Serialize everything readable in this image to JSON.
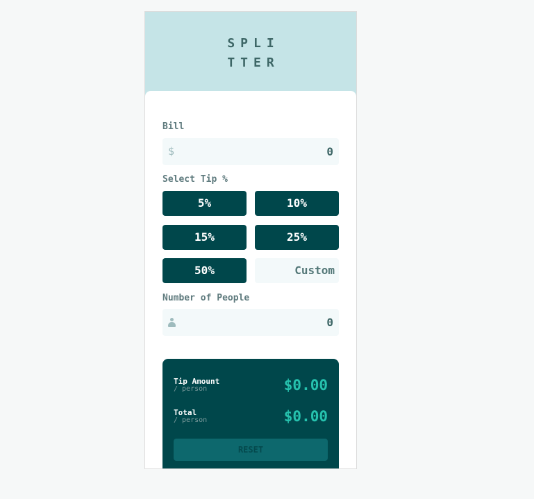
{
  "logo": {
    "line1": "SPLI",
    "line2": "TTER"
  },
  "bill": {
    "label": "Bill",
    "prefix": "$",
    "value": "0"
  },
  "tip": {
    "label": "Select Tip %",
    "options": [
      "5%",
      "10%",
      "15%",
      "25%",
      "50%"
    ],
    "custom_placeholder": "Custom"
  },
  "people": {
    "label": "Number of People",
    "value": "0"
  },
  "results": {
    "tip_label": "Tip Amount",
    "tip_sub": "/ person",
    "tip_value": "$0.00",
    "total_label": "Total",
    "total_sub": "/ person",
    "total_value": "$0.00",
    "reset_label": "RESET"
  },
  "colors": {
    "dark_cyan": "#00474b",
    "strong_cyan": "#26c2ae",
    "light_cyan": "#c5e4e7",
    "input_bg": "#f3f9fa"
  }
}
